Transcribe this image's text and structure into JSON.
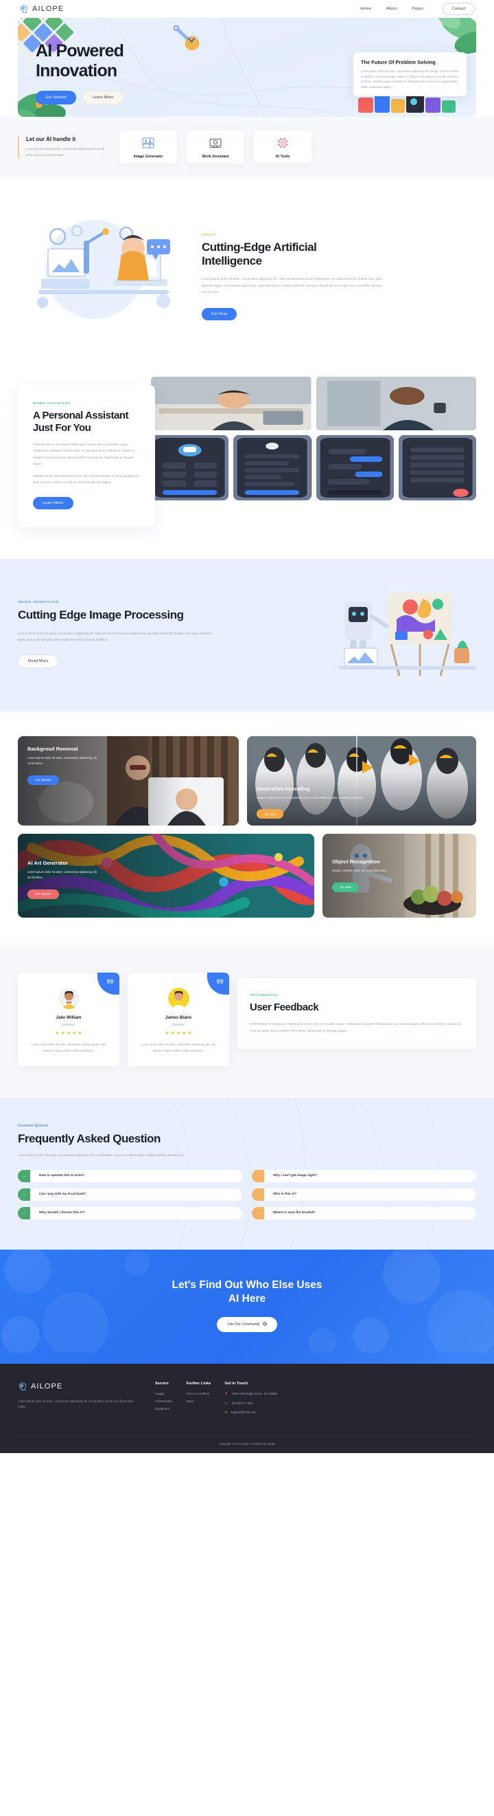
{
  "brand": {
    "name": "AILOPE",
    "logo_icon": "ai-head-icon"
  },
  "nav": {
    "links": [
      {
        "label": "Home",
        "icon": null
      },
      {
        "label": "About",
        "icon": null
      },
      {
        "label": "Pages",
        "icon": "chevron-down-icon"
      }
    ],
    "contact_label": "Contact"
  },
  "hero": {
    "title_line1": "AI Powered",
    "title_line2": "Innovation",
    "primary_btn": "Get Started",
    "secondary_btn": "Learn More",
    "card": {
      "title": "The Future Of Problem Solving",
      "body": "Lorem ipsum dolor sit amet, consectetur adipiscing elit. Integer ornare ut lorem et eleifend. Sed id venenatis metus, in finibus enim. Mauris convallis velit arcu, sit amet convallis neque convallis ut. Vivamus rhoncus leo ut ex feugiat mattis. Etiam ut aliquam sapien."
    },
    "swatch_colors": [
      "#f6d9b0",
      "#f6d9b0",
      "#5fb776",
      "#5fb776",
      "#6e9ef5",
      "#6e9ef5",
      "#a07ee8",
      "#f6c27a",
      "#5fb776",
      "#5fb776",
      "#6e9ef5",
      "#f0e2cf",
      "#f0a3a3",
      "#f6c27a",
      "#f0e2cf",
      "#e05a5a"
    ]
  },
  "features": {
    "intro_title": "Let our AI handle it",
    "intro_body": "Lorem ipsum dolor sit amet, consectetur adipiscing elit. Ut elit tellus, luctus nec ullamcorper.",
    "cards": [
      {
        "label": "Image Generator",
        "icon": "image-generator-icon"
      },
      {
        "label": "Work Assistant",
        "icon": "work-assistant-icon"
      },
      {
        "label": "AI Tools",
        "icon": "ai-tools-icon"
      }
    ]
  },
  "about": {
    "eyebrow": "ABOUT",
    "title": "Cutting-Edge Artificial Intelligence",
    "body": "Lorem ipsum dolor sit amet, consectetur adipiscing elit. Nam sit amet arcu lacus. Maecenas nec diam hendrerit, finibus nunc eget, pharetra ligula. Sed pulvinar ligula dolor, eget elementum massa mollis id. Quisque lobortis est accumsan nunc convallis interdum non eu arcu.",
    "btn": "Get Now"
  },
  "assistant": {
    "eyebrow": "WORK ASSISTANT",
    "title": "A Personal Assistant Just For You",
    "body1": "Pellentesque in erat purus. Morbi quis ornare nisl, a convallis augue. Vestibulum vulputate finibus diam, ac faucibus quam ultricies a. Donec a mauris id urna tincidunt varius porttitor sed mauris. Maecenas ac feugiat augue.",
    "body2": "Molestie tortor non imperdiet luctus. Duis eleifend turpis ut vehicula placerat. Duis erat nisi, pretium in nisi ut, tincidunt ultrices magna.",
    "btn": "Learn More"
  },
  "image_processing": {
    "eyebrow": "IMAGE GENERATOR",
    "title": "Cutting Edge Image Processing",
    "body": "Lorem ipsum dolor sit amet, consectetur adipiscing elit. Nam sit amet arcu lacus. Maecenas nec diam hendrerit, finibus nunc eget, pharetra ligula. Sed pulvinar ligula dolor, eget elementum massa mollis id.",
    "btn": "Read More"
  },
  "gallery": {
    "cards": [
      {
        "title": "Backgroud Removal",
        "body": "Lorem ipsum dolor sit amet, consectetur adipiscing elit. Ut elit tellus.",
        "btn": "Get Started",
        "btn_color": "#3b7bf6"
      },
      {
        "title": "Generative Upscaling",
        "body": "Integer molestie tortor non imperdiet luctus. Duis eleifend turpis ut vehicula placerat.",
        "btn": "Try Now",
        "btn_color": "#f5a742"
      },
      {
        "title": "AI Art Generator",
        "body": "Lorem ipsum dolor sit amet, consectetur adipiscing elit. Ut elit tellus.",
        "btn": "Get Started",
        "btn_color": "#ef6a6a"
      },
      {
        "title": "Object Recognition",
        "body": "Integer molestie tortor non imperdiet luctus.",
        "btn": "Try Now",
        "btn_color": "#43c08b"
      }
    ]
  },
  "testimonials": {
    "eyebrow": "TESTIMONIAL",
    "title": "User Feedback",
    "body": "Pellentesque in erat purus. Morbi quis ornare nisl, a convallis augue. Vestibulum vulputate finibus diam, ac faucibus quam ultricies a. Donec a mauris id urna tincidunt varius porttitor sed mauris. Maecenas ac feugiat augue.",
    "quote_mark": "99",
    "cards": [
      {
        "name": "Jake William",
        "role": "Designer",
        "rating": 5,
        "quote": "Lorem ipsum dolor sit amet, consectetur adipiscing elit. Sed ultricies magna ut felis mattis vestibulum.",
        "avatar_bg": "#f2f2f2"
      },
      {
        "name": "James Blaire",
        "role": "Designer",
        "rating": 5,
        "quote": "Lorem ipsum dolor sit amet, consectetur adipiscing elit. Sed ultricies magna ut felis mattis vestibulum.",
        "avatar_bg": "#f6d52e"
      }
    ]
  },
  "faq": {
    "eyebrow": "Common Queries",
    "title": "Frequently Asked Question",
    "body": "Lorem ipsum dolor sit amet, consectetur adipiscing elit. Ut elit tellus, luctus nec ullamcorper mattis, pulvinar dapibus leo.",
    "left_color": "#4aa96c",
    "right_color": "#f5b263",
    "left": [
      {
        "q": "How to operate this AI tools?",
        "icon": "chevron-down-icon"
      },
      {
        "q": "Can i pay with my local bank?",
        "icon": "chevron-down-icon"
      },
      {
        "q": "Why should i choose this AI?",
        "icon": "chevron-down-icon"
      }
    ],
    "right": [
      {
        "q": "Why i can't get image right?",
        "icon": "chevron-down-icon"
      },
      {
        "q": "Who is this AI?",
        "icon": "chevron-down-icon"
      },
      {
        "q": "Where is save file located?",
        "icon": "chevron-down-icon"
      }
    ]
  },
  "cta": {
    "line1": "Let's Find Out Who Else Uses",
    "line2": "AI Here",
    "btn": "Join Our Community",
    "btn_icon": "arrow-right-icon"
  },
  "footer": {
    "about": "Lorem ipsum dolor sit amet, consectetur adipiscing elit. Ut elit tellus, luctus nec ullamcorper mattis.",
    "columns": [
      {
        "title": "Service",
        "items": [
          "Supply",
          "Communities",
          "Equipment"
        ]
      },
      {
        "title": "Further Links",
        "items": [
          "Term & Condition",
          "News"
        ]
      }
    ],
    "contact": {
      "title": "Get In Touch",
      "address": "2463 Oak Ridge Circle, GA 45905",
      "phone": "(407)876-7-853",
      "email": "support@izide.com",
      "address_icon": "location-pin-icon",
      "phone_icon": "phone-icon",
      "email_icon": "envelope-icon"
    },
    "copyright": "Copyright © 2024 ailope | Powered by ailope"
  }
}
